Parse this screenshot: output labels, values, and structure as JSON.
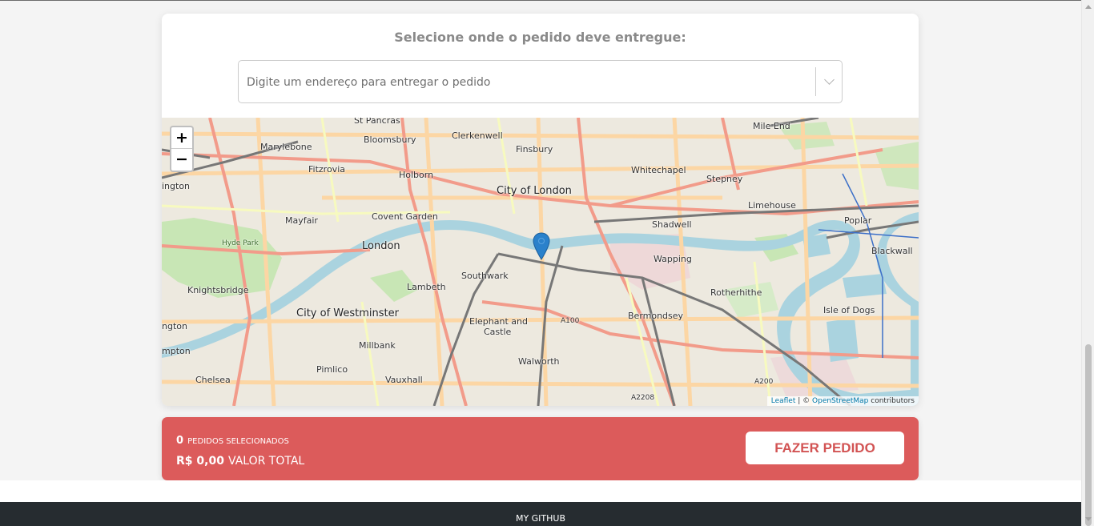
{
  "delivery": {
    "title": "Selecione onde o pedido deve entregue:",
    "address_placeholder": "Digite um endereço para entregar o pedido"
  },
  "map": {
    "zoom_in": "+",
    "zoom_out": "−",
    "labels": {
      "st_pancras": "St Pancras",
      "clerkenwell": "Clerkenwell",
      "marylebone": "Marylebone",
      "bloomsbury": "Bloomsbury",
      "finsbury": "Finsbury",
      "mile_end": "Mile End",
      "fitzrovia": "Fitzrovia",
      "holborn": "Holborn",
      "whitechapel": "Whitechapel",
      "stepney": "Stepney",
      "city_of_london": "City of London",
      "limehouse": "Limehouse",
      "mayfair": "Mayfair",
      "covent_garden": "Covent Garden",
      "shadwell": "Shadwell",
      "poplar": "Poplar",
      "london": "London",
      "hyde_park": "Hyde Park",
      "wapping": "Wapping",
      "blackwall": "Blackwall",
      "southwark": "Southwark",
      "knightsbridge": "Knightsbridge",
      "lambeth": "Lambeth",
      "rotherhithe": "Rotherhithe",
      "city_of_westminster": "City of Westminster",
      "bermondsey": "Bermondsey",
      "isle_of_dogs": "Isle of Dogs",
      "elephant_and": "Elephant and",
      "castle": "Castle",
      "a100": "A100",
      "millbank": "Millbank",
      "pimlico": "Pimlico",
      "walworth": "Walworth",
      "chelsea": "Chelsea",
      "vauxhall": "Vauxhall",
      "a200": "A200",
      "a2208": "A2208",
      "ington": "ington",
      "ngton": "ngton",
      "mpton": "mpton"
    },
    "attribution": {
      "leaflet": "Leaflet",
      "sep": " | © ",
      "osm": "OpenStreetMap",
      "contributors": " contributors"
    }
  },
  "summary": {
    "count": "0",
    "count_label": "PEDIDOS SELECIONADOS",
    "total": "R$ 0,00",
    "total_label": "VALOR TOTAL",
    "order_button": "FAZER PEDIDO"
  },
  "footer": {
    "github_link": "MY GITHUB"
  },
  "colors": {
    "accent": "#dc5b5b",
    "footer_bg": "#262c30",
    "marker": "#2a81cb",
    "river": "#aad3df"
  }
}
